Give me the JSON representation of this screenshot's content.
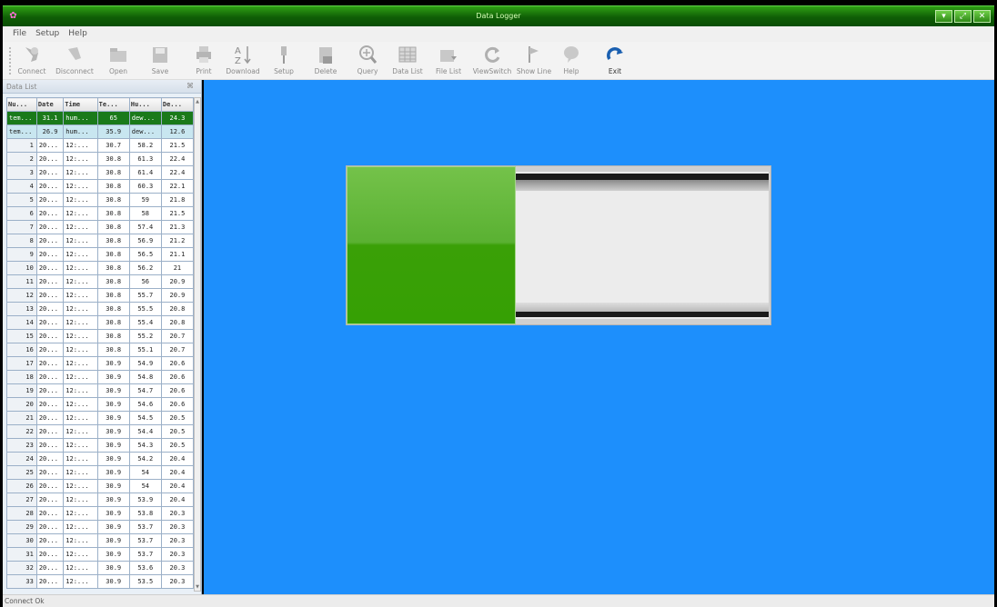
{
  "window": {
    "title": "Data Logger",
    "buttons": [
      "▾",
      "⤢",
      "✕"
    ]
  },
  "menu": [
    "File",
    "Setup",
    "Help"
  ],
  "toolbar": [
    {
      "label": "Connect",
      "icon": "connect-icon",
      "glyph": "⚲"
    },
    {
      "label": "Disconnect",
      "icon": "disconnect-icon",
      "glyph": "⚲"
    },
    {
      "label": "Open",
      "icon": "open-folder-icon",
      "glyph": "▭"
    },
    {
      "label": "Save",
      "icon": "save-icon",
      "glyph": "▣"
    },
    {
      "label": "Print",
      "icon": "printer-icon",
      "glyph": "⎙"
    },
    {
      "label": "Download",
      "icon": "sort-az-icon",
      "glyph": "A↓"
    },
    {
      "label": "Setup",
      "icon": "setup-icon",
      "glyph": "⚙"
    },
    {
      "label": "Delete",
      "icon": "delete-icon",
      "glyph": "▤"
    },
    {
      "label": "Query",
      "icon": "magnifier-icon",
      "glyph": "⊕"
    },
    {
      "label": "Data List",
      "icon": "data-list-icon",
      "glyph": "▦"
    },
    {
      "label": "File List",
      "icon": "file-list-icon",
      "glyph": "▭"
    },
    {
      "label": "ViewSwitch",
      "icon": "refresh-icon",
      "glyph": "↻"
    },
    {
      "label": "Show Line",
      "icon": "flag-icon",
      "glyph": "⚑"
    },
    {
      "label": "Help",
      "icon": "help-bubble-icon",
      "glyph": "●"
    },
    {
      "label": "Exit",
      "icon": "exit-arrow-icon",
      "glyph": "↷"
    }
  ],
  "panel": {
    "title": "Data List",
    "pin": "⌘",
    "columns": [
      "Nu...",
      "Date",
      "Time",
      "Te...",
      "Hu...",
      "De..."
    ],
    "rows": [
      [
        "tem...",
        "31.1",
        "hum...",
        "65",
        "dew...",
        "24.3"
      ],
      [
        "tem...",
        "26.9",
        "hum...",
        "35.9",
        "dew...",
        "12.6"
      ],
      [
        "1",
        "20...",
        "12:...",
        "30.7",
        "58.2",
        "21.5"
      ],
      [
        "2",
        "20...",
        "12:...",
        "30.8",
        "61.3",
        "22.4"
      ],
      [
        "3",
        "20...",
        "12:...",
        "30.8",
        "61.4",
        "22.4"
      ],
      [
        "4",
        "20...",
        "12:...",
        "30.8",
        "60.3",
        "22.1"
      ],
      [
        "5",
        "20...",
        "12:...",
        "30.8",
        "59",
        "21.8"
      ],
      [
        "6",
        "20...",
        "12:...",
        "30.8",
        "58",
        "21.5"
      ],
      [
        "7",
        "20...",
        "12:...",
        "30.8",
        "57.4",
        "21.3"
      ],
      [
        "8",
        "20...",
        "12:...",
        "30.8",
        "56.9",
        "21.2"
      ],
      [
        "9",
        "20...",
        "12:...",
        "30.8",
        "56.5",
        "21.1"
      ],
      [
        "10",
        "20...",
        "12:...",
        "30.8",
        "56.2",
        "21"
      ],
      [
        "11",
        "20...",
        "12:...",
        "30.8",
        "56",
        "20.9"
      ],
      [
        "12",
        "20...",
        "12:...",
        "30.8",
        "55.7",
        "20.9"
      ],
      [
        "13",
        "20...",
        "12:...",
        "30.8",
        "55.5",
        "20.8"
      ],
      [
        "14",
        "20...",
        "12:...",
        "30.8",
        "55.4",
        "20.8"
      ],
      [
        "15",
        "20...",
        "12:...",
        "30.8",
        "55.2",
        "20.7"
      ],
      [
        "16",
        "20...",
        "12:...",
        "30.8",
        "55.1",
        "20.7"
      ],
      [
        "17",
        "20...",
        "12:...",
        "30.9",
        "54.9",
        "20.6"
      ],
      [
        "18",
        "20...",
        "12:...",
        "30.9",
        "54.8",
        "20.6"
      ],
      [
        "19",
        "20...",
        "12:...",
        "30.9",
        "54.7",
        "20.6"
      ],
      [
        "20",
        "20...",
        "12:...",
        "30.9",
        "54.6",
        "20.6"
      ],
      [
        "21",
        "20...",
        "12:...",
        "30.9",
        "54.5",
        "20.5"
      ],
      [
        "22",
        "20...",
        "12:...",
        "30.9",
        "54.4",
        "20.5"
      ],
      [
        "23",
        "20...",
        "12:...",
        "30.9",
        "54.3",
        "20.5"
      ],
      [
        "24",
        "20...",
        "12:...",
        "30.9",
        "54.2",
        "20.4"
      ],
      [
        "25",
        "20...",
        "12:...",
        "30.9",
        "54",
        "20.4"
      ],
      [
        "26",
        "20...",
        "12:...",
        "30.9",
        "54",
        "20.4"
      ],
      [
        "27",
        "20...",
        "12:...",
        "30.9",
        "53.9",
        "20.4"
      ],
      [
        "28",
        "20...",
        "12:...",
        "30.9",
        "53.8",
        "20.3"
      ],
      [
        "29",
        "20...",
        "12:...",
        "30.9",
        "53.7",
        "20.3"
      ],
      [
        "30",
        "20...",
        "12:...",
        "30.9",
        "53.7",
        "20.3"
      ],
      [
        "31",
        "20...",
        "12:...",
        "30.9",
        "53.7",
        "20.3"
      ],
      [
        "32",
        "20...",
        "12:...",
        "30.9",
        "53.6",
        "20.3"
      ],
      [
        "33",
        "20...",
        "12:...",
        "30.9",
        "53.5",
        "20.3"
      ]
    ]
  },
  "progress": {
    "fraction": 0.4
  },
  "status": "Connect Ok",
  "colors": {
    "titlebar": "#1a7a10",
    "main_bg": "#1d8ffc",
    "progress_fill": "#3aa007"
  }
}
